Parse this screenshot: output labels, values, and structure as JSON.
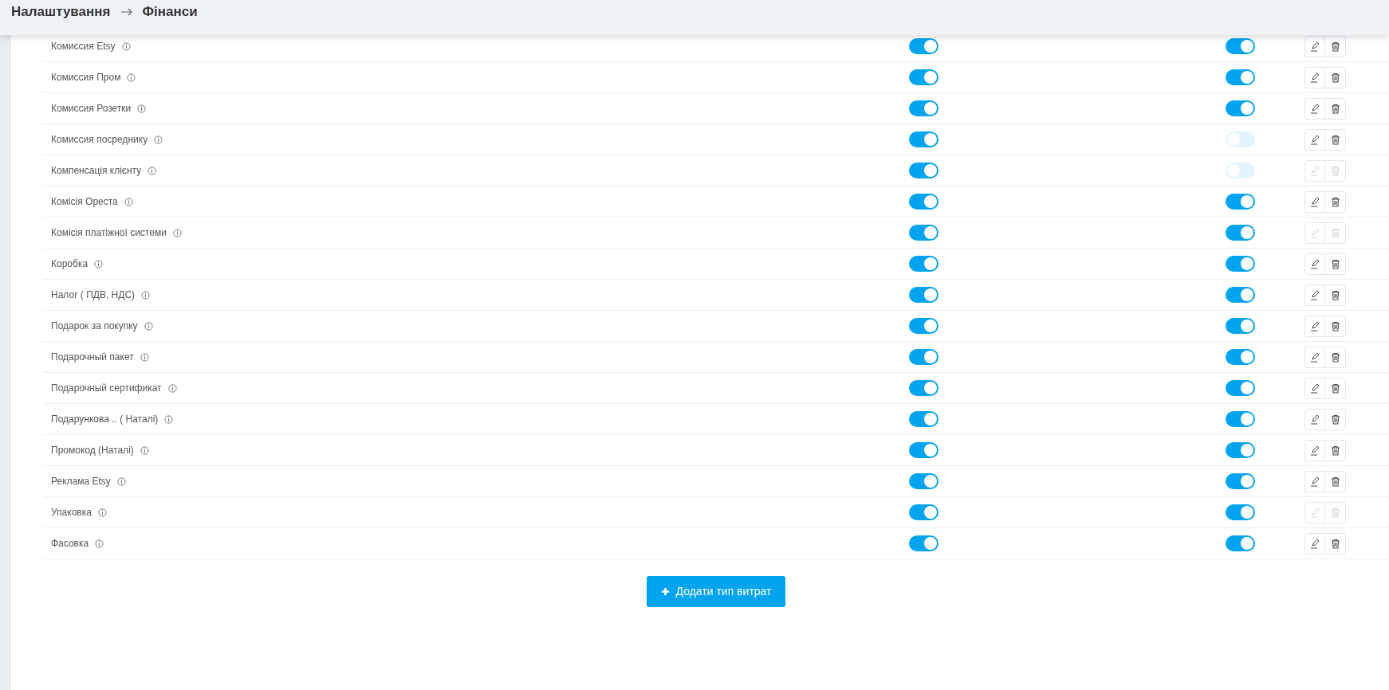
{
  "breadcrumb": {
    "parent": "Налаштування",
    "current": "Фінанси"
  },
  "rows": [
    {
      "label": "Комиссия Etsy",
      "switch_1": true,
      "switch_2": true,
      "disabled": false
    },
    {
      "label": "Комиссия Пром",
      "switch_1": true,
      "switch_2": true,
      "disabled": false
    },
    {
      "label": "Комиссия Розетки",
      "switch_1": true,
      "switch_2": true,
      "disabled": false
    },
    {
      "label": "Комиссия посреднику",
      "switch_1": true,
      "switch_2": false,
      "disabled": false
    },
    {
      "label": "Компенсація клієнту",
      "switch_1": true,
      "switch_2": false,
      "disabled": true
    },
    {
      "label": "Комісія Ореста",
      "switch_1": true,
      "switch_2": true,
      "disabled": false
    },
    {
      "label": "Комісія платіжної системи",
      "switch_1": true,
      "switch_2": true,
      "disabled": true
    },
    {
      "label": "Коробка",
      "switch_1": true,
      "switch_2": true,
      "disabled": false
    },
    {
      "label": "Налог ( ПДВ, НДС)",
      "switch_1": true,
      "switch_2": true,
      "disabled": false
    },
    {
      "label": "Подарок за покупку",
      "switch_1": true,
      "switch_2": true,
      "disabled": false
    },
    {
      "label": "Подарочный пакет",
      "switch_1": true,
      "switch_2": true,
      "disabled": false
    },
    {
      "label": "Подарочный сертификат",
      "switch_1": true,
      "switch_2": true,
      "disabled": false
    },
    {
      "label": "Подарункова .. ( Наталі)",
      "switch_1": true,
      "switch_2": true,
      "disabled": false
    },
    {
      "label": "Промокод (Наталі)",
      "switch_1": true,
      "switch_2": true,
      "disabled": false
    },
    {
      "label": "Реклама Etsy",
      "switch_1": true,
      "switch_2": true,
      "disabled": false
    },
    {
      "label": "Упаковка",
      "switch_1": true,
      "switch_2": true,
      "disabled": true
    },
    {
      "label": "Фасовка",
      "switch_1": true,
      "switch_2": true,
      "disabled": false
    }
  ],
  "add_button": "Додати тип витрат"
}
